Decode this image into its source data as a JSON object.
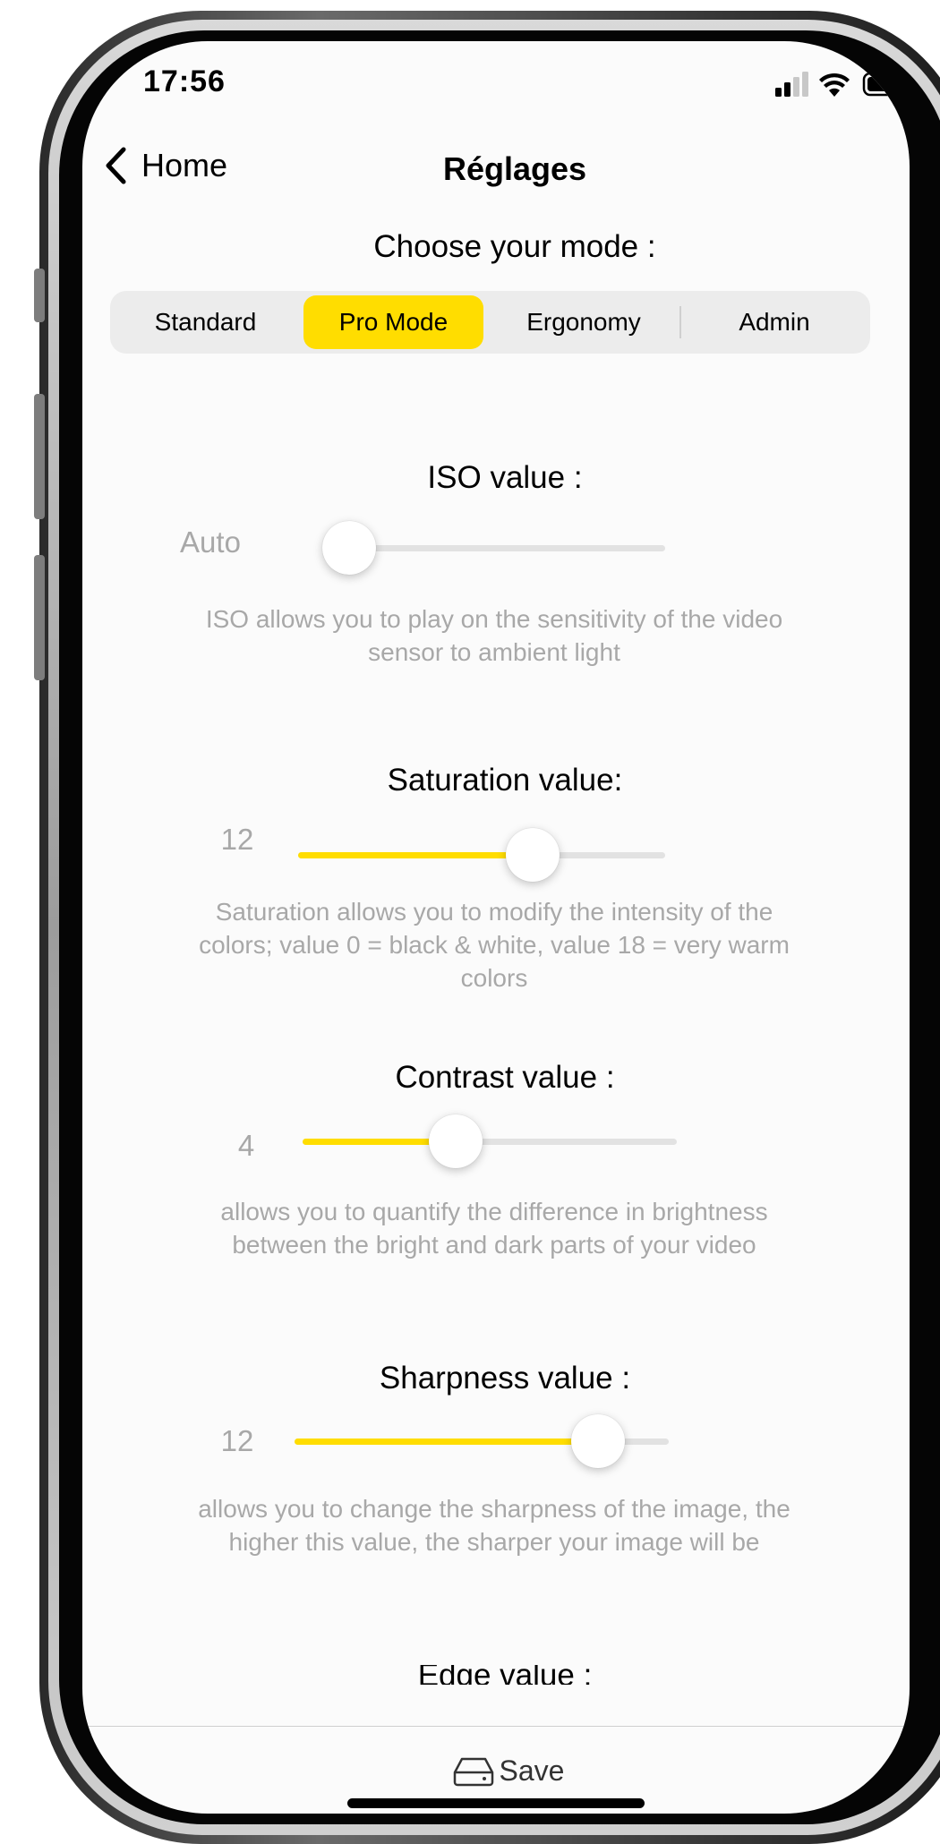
{
  "status_bar": {
    "time": "17:56",
    "icons": [
      "signal-icon",
      "wifi-icon",
      "battery-icon"
    ]
  },
  "nav": {
    "back_label": "Home",
    "title": "Réglages"
  },
  "mode": {
    "title": "Choose your mode :",
    "options": [
      "Standard",
      "Pro Mode",
      "Ergonomy",
      "Admin"
    ],
    "selected": "Pro Mode"
  },
  "settings": {
    "iso": {
      "title": "ISO value :",
      "value": "Auto",
      "fill_fraction": 0.0,
      "description": "ISO allows you to play on the sensitivity of the video sensor to ambient light"
    },
    "saturation": {
      "title": "Saturation value:",
      "value": "12",
      "fill_fraction": 0.64,
      "description": "Saturation allows you to modify the intensity of the colors; value 0 = black & white, value 18 = very warm colors"
    },
    "contrast": {
      "title": "Contrast value :",
      "value": "4",
      "fill_fraction": 0.41,
      "description": "allows you to quantify the difference in brightness between the bright and dark parts of your video"
    },
    "sharpness": {
      "title": "Sharpness value :",
      "value": "12",
      "fill_fraction": 0.81,
      "description": "allows you to change the sharpness of the image, the higher this value, the sharper your image will be"
    },
    "edge": {
      "title": "Edge value :"
    }
  },
  "footer": {
    "save_label": "Save"
  },
  "colors": {
    "accent": "#ffdd00",
    "muted_text": "#a8a8a8",
    "track": "#e2e2e2"
  }
}
